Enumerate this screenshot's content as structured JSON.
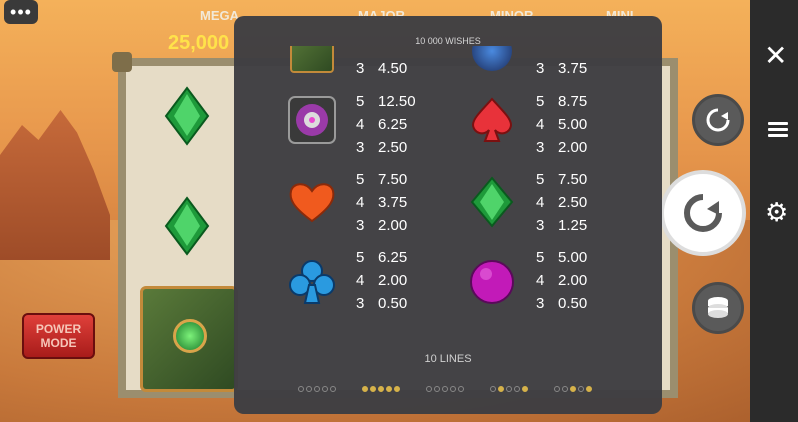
{
  "menu": {
    "icon": "more-dots-icon",
    "label": "•••"
  },
  "jackpots": {
    "mega_label": "MEGA",
    "major_label": "MAJOR",
    "minor_label": "MINOR",
    "mini_label": "MINI",
    "mega_value": "25,000"
  },
  "power_mode": {
    "line1": "POWER",
    "line2": "MODE"
  },
  "side_controls": {
    "close_icon": "close-icon",
    "paytable_icon": "list-icon",
    "settings_icon": "gear-icon",
    "close_glyph": "✕",
    "settings_glyph": "⚙"
  },
  "paytable": {
    "title": "10 000 WISHES",
    "rows": [
      {
        "left": {
          "symbol": "book-icon",
          "pays": [
            [
              "3",
              "4.50"
            ]
          ]
        },
        "right": {
          "symbol": "blue-orb-icon",
          "pays": [
            [
              "3",
              "3.75"
            ]
          ]
        }
      },
      {
        "left": {
          "symbol": "compass-amulet-icon",
          "pays": [
            [
              "5",
              "12.50"
            ],
            [
              "4",
              "6.25"
            ],
            [
              "3",
              "2.50"
            ]
          ]
        },
        "right": {
          "symbol": "spade-icon",
          "pays": [
            [
              "5",
              "8.75"
            ],
            [
              "4",
              "5.00"
            ],
            [
              "3",
              "2.00"
            ]
          ]
        }
      },
      {
        "left": {
          "symbol": "heart-icon",
          "pays": [
            [
              "5",
              "7.50"
            ],
            [
              "4",
              "3.75"
            ],
            [
              "3",
              "2.00"
            ]
          ]
        },
        "right": {
          "symbol": "diamond-icon",
          "pays": [
            [
              "5",
              "7.50"
            ],
            [
              "4",
              "2.50"
            ],
            [
              "3",
              "1.25"
            ]
          ]
        }
      },
      {
        "left": {
          "symbol": "club-icon",
          "pays": [
            [
              "5",
              "6.25"
            ],
            [
              "4",
              "2.00"
            ],
            [
              "3",
              "0.50"
            ]
          ]
        },
        "right": {
          "symbol": "purple-circle-icon",
          "pays": [
            [
              "5",
              "5.00"
            ],
            [
              "4",
              "2.00"
            ],
            [
              "3",
              "0.50"
            ]
          ]
        }
      }
    ],
    "lines_label": "10 LINES"
  },
  "colors": {
    "overlay": "#3e3e42",
    "accent_gold": "#d6b24a",
    "jackpot_yellow": "#ffe24a",
    "power_red": "#c22a26"
  }
}
